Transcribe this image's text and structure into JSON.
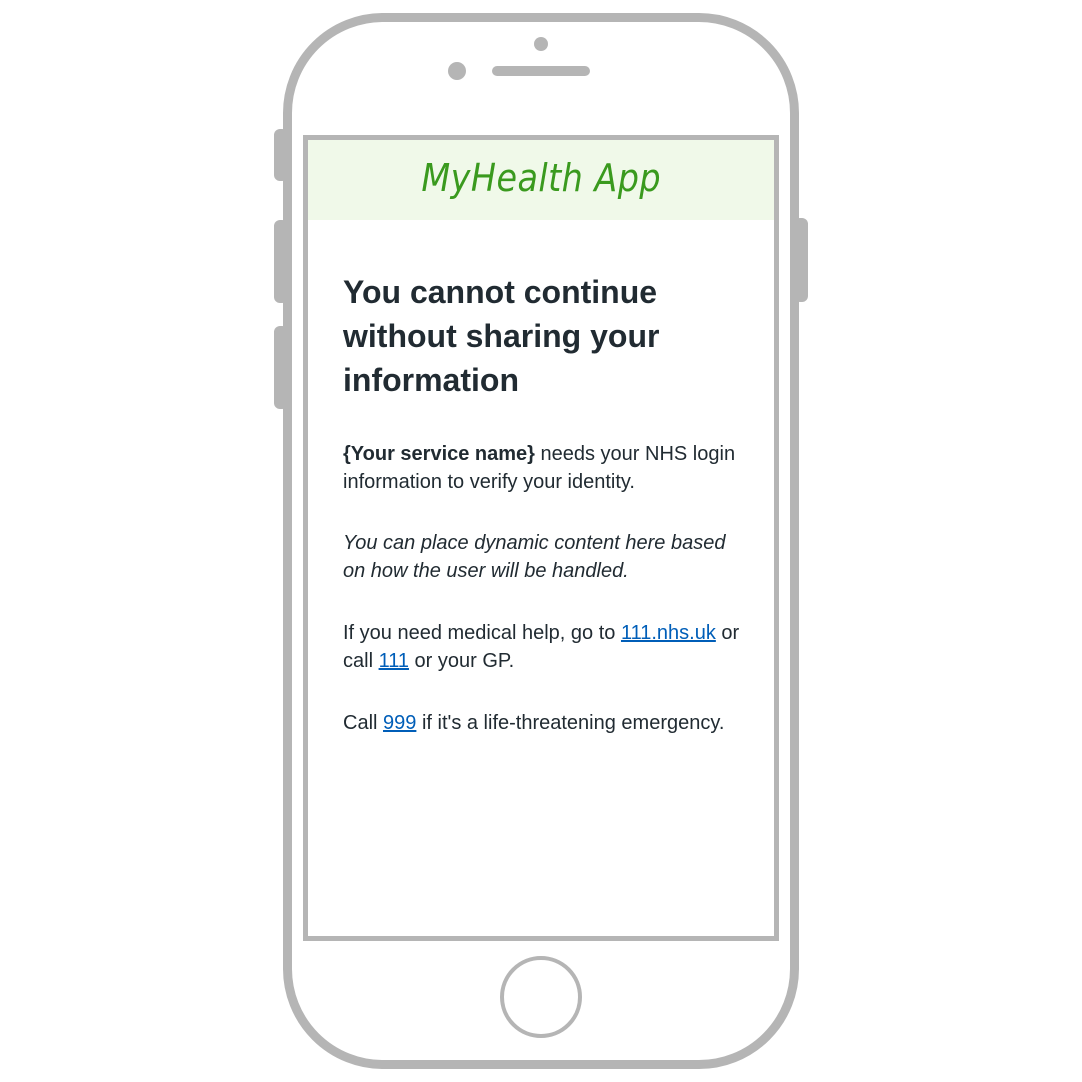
{
  "app": {
    "title": "MyHealth App"
  },
  "page": {
    "heading": "You cannot continue without sharing your information",
    "service_name": "{Your service name}",
    "service_text": " needs your NHS login information to verify your identity.",
    "dynamic_note": "You can place dynamic content here based on how the user will be handled.",
    "medical_help_prefix": "If you need medical help, go to ",
    "link_111_site": "111.nhs.uk",
    "or_call": " or call ",
    "link_111": "111",
    "or_gp": " or your GP.",
    "call_prefix": "Call ",
    "link_999": "999",
    "emergency_suffix": " if it's a life-threatening emergency."
  },
  "colors": {
    "brand_green": "#3a9a1e",
    "header_bg": "#f0f9e9",
    "link": "#005eb8",
    "text": "#212b32",
    "frame": "#b5b5b5"
  }
}
